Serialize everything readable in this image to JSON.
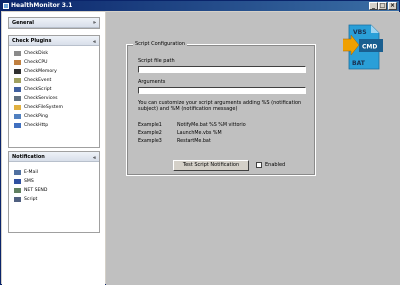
{
  "window": {
    "title": "HealthMonitor 3.1",
    "min": "_",
    "max": "□",
    "close": "×"
  },
  "sidebar": {
    "general": {
      "title": "General",
      "chevron": "»"
    },
    "plugins": {
      "title": "Check Plugins",
      "chevron": "»",
      "items": [
        {
          "label": "CheckDisk",
          "color": "#8a8a8a"
        },
        {
          "label": "CheckCPU",
          "color": "#c08040"
        },
        {
          "label": "CheckMemory",
          "color": "#303030"
        },
        {
          "label": "CheckEvent",
          "color": "#a0a060"
        },
        {
          "label": "CheckScript",
          "color": "#4060a0"
        },
        {
          "label": "CheckServices",
          "color": "#607080"
        },
        {
          "label": "CheckFileSystem",
          "color": "#e0b040"
        },
        {
          "label": "CheckPing",
          "color": "#5080c0"
        },
        {
          "label": "CheckHttp",
          "color": "#4070c0"
        }
      ]
    },
    "notification": {
      "title": "Notification",
      "chevron": "»",
      "items": [
        {
          "label": "E-Mail",
          "color": "#5070a0"
        },
        {
          "label": "SMS",
          "color": "#3050a0"
        },
        {
          "label": "NET SEND",
          "color": "#608060"
        },
        {
          "label": "Script",
          "color": "#506080"
        }
      ]
    }
  },
  "config": {
    "legend": "Script Configuration",
    "path_label": "Script file path",
    "path_value": "",
    "args_label": "Arguments",
    "args_value": "",
    "help_text": "You can customize your script arguments adding %S (notification subject) and %M (notification message)",
    "examples": [
      {
        "label": "Example1",
        "value": "NotifyMe.bat %S %M vittorio"
      },
      {
        "label": "Example2",
        "value": "LaunchMe.vbs %M"
      },
      {
        "label": "Example3",
        "value": "RestartMe.bat"
      }
    ],
    "test_button": "Test Script Notification",
    "enabled_label": "Enabled",
    "enabled": false
  },
  "logo": {
    "vbs": "VBS",
    "cmd": "CMD",
    "bat": "BAT",
    "accent": "#2a9fd8",
    "arrow": "#f0a000"
  }
}
